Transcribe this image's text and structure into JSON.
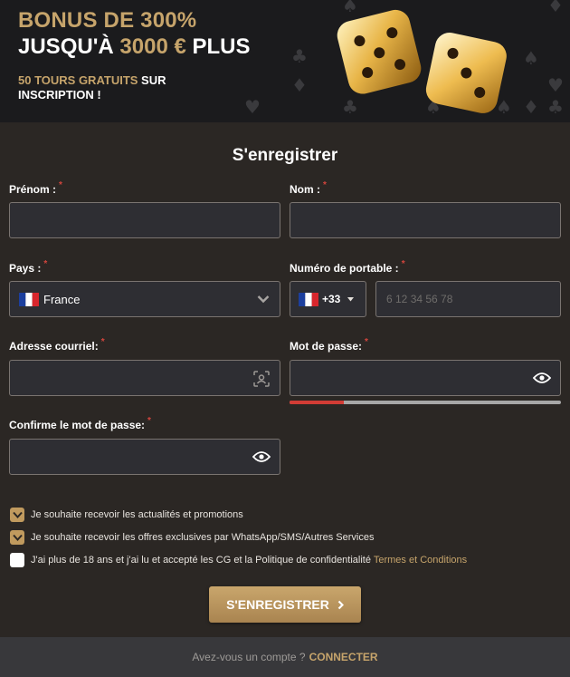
{
  "banner": {
    "bonus_line1": "BONUS DE 300%",
    "line2_prefix": "JUSQU'À ",
    "line2_amount": "3000 €",
    "line2_suffix": " PLUS",
    "spins_gold": "50 TOURS GRATUITS",
    "spins_rest": " SUR INSCRIPTION !",
    "accent_color": "#c6a46b"
  },
  "form": {
    "title": "S'enregistrer",
    "required_mark": "*",
    "first_name": {
      "label": "Prénom :",
      "value": ""
    },
    "last_name": {
      "label": "Nom :",
      "value": ""
    },
    "country": {
      "label": "Pays :",
      "value": "France",
      "flag": "fr-flag-icon"
    },
    "phone": {
      "label": "Numéro de portable :",
      "code": "+33",
      "placeholder": "6 12 34 56 78"
    },
    "email": {
      "label": "Adresse courriel:",
      "value": "",
      "icon": "autofill-icon"
    },
    "password": {
      "label": "Mot de passe:",
      "value": "",
      "strength": 0.2,
      "strength_color": "#d23c35"
    },
    "confirm_password": {
      "label": "Confirme le mot de passe:",
      "value": ""
    }
  },
  "checkboxes": [
    {
      "text": "Je souhaite recevoir les actualités et promotions",
      "checked": true
    },
    {
      "text": "Je souhaite recevoir les offres exclusives par WhatsApp/SMS/Autres Services",
      "checked": true
    },
    {
      "text": "J'ai plus de 18 ans et j'ai lu et accepté les CG et la Politique de confidentialité ",
      "link": "Termes et Conditions",
      "checked": false
    }
  ],
  "submit": {
    "label": "S'ENREGISTRER"
  },
  "footer": {
    "question": "Avez-vous un compte ?",
    "connect": "CONNECTER"
  }
}
